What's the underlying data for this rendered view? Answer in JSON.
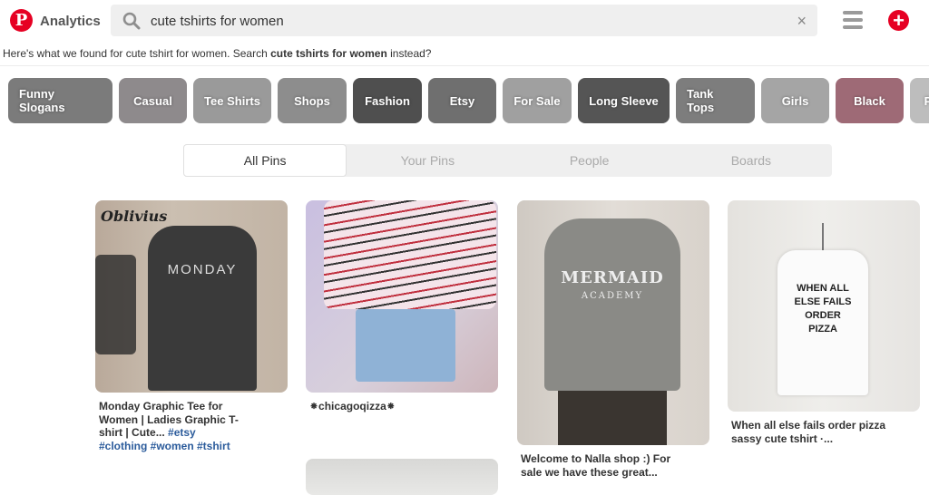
{
  "header": {
    "logo_letter": "P",
    "app_name": "Analytics",
    "search_value": "cute tshirts for women",
    "clear_symbol": "×",
    "add_symbol": "+"
  },
  "search_notice": {
    "prefix": "Here's what we found for cute tshirt for women. Search ",
    "suggestion": "cute tshirts for women",
    "suffix": " instead?"
  },
  "chips": [
    {
      "label": "Funny Slogans",
      "color": "#7b7b7b"
    },
    {
      "label": "Casual",
      "color": "#8e8a8c"
    },
    {
      "label": "Tee Shirts",
      "color": "#9a9a9a"
    },
    {
      "label": "Shops",
      "color": "#8d8d8d"
    },
    {
      "label": "Fashion",
      "color": "#4f4f4f"
    },
    {
      "label": "Etsy",
      "color": "#6f6f6f"
    },
    {
      "label": "For Sale",
      "color": "#a0a0a0"
    },
    {
      "label": "Long Sleeve",
      "color": "#555555"
    },
    {
      "label": "Tank Tops",
      "color": "#7d7d7d"
    },
    {
      "label": "Girls",
      "color": "#a5a5a5"
    },
    {
      "label": "Black",
      "color": "#9e6a76"
    },
    {
      "label": "P",
      "color": "#bdbdbd"
    }
  ],
  "tabs": [
    {
      "label": "All Pins",
      "active": true
    },
    {
      "label": "Your Pins",
      "active": false
    },
    {
      "label": "People",
      "active": false
    },
    {
      "label": "Boards",
      "active": false
    }
  ],
  "pins": [
    {
      "image_caption": "Oblivius",
      "shirt_text": "MONDAY",
      "description": "Monday Graphic Tee for Women | Ladies Graphic T-shirt | Cute... ",
      "tags": "#etsy #clothing #women #tshirt"
    },
    {
      "description": "⁕chicagoqizza⁕"
    },
    {
      "shirt_text_1": "MERMAID",
      "shirt_text_2": "ACADEMY",
      "description": "Welcome to Nalla shop :) For sale we have these great..."
    },
    {
      "shirt_text": "WHEN ALL ELSE FAILS ORDER PIZZA",
      "description": "When all else fails order pizza sassy cute tshirt ·..."
    }
  ]
}
